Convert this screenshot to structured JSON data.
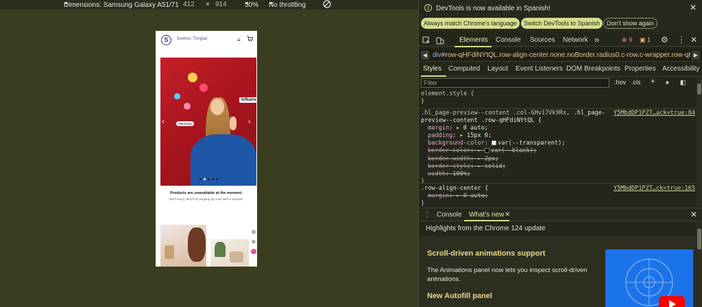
{
  "device_toolbar": {
    "dimensions_label": "Dimensions: Samsung Galaxy A51/71",
    "width": "412",
    "times": "×",
    "height": "914",
    "zoom": "50%",
    "throttling": "No throttling"
  },
  "page": {
    "brand": "Somos Tingtal",
    "hero": {
      "tag_influence": "Influence",
      "tag_marketing": "Marketing"
    },
    "empty_title": "Products are unavailable at the moment.",
    "empty_sub": "Don't worry, they'll be popping up soon with a surprise."
  },
  "devtools": {
    "notice": {
      "text": "DevTools is now available in Spanish!",
      "btn_match": "Always match Chrome's language",
      "btn_switch": "Switch DevTools to Spanish",
      "btn_dismiss": "Don't show again"
    },
    "tabs": [
      "Elements",
      "Console",
      "Sources",
      "Network"
    ],
    "more_tabs": "»",
    "errors": "9",
    "warnings": "1",
    "breadcrumb": {
      "tag": "div",
      "selector": "#row-qHFdiNYtQL.row-align-center.none.noBorder.radius0.c-row.c-wrapper.row-qHFdiNYtQL"
    },
    "style_tabs": [
      "Styles",
      "Computed",
      "Layout",
      "Event Listeners",
      "DOM Breakpoints",
      "Properties",
      "Accessibility"
    ],
    "filter_placeholder": "Filter",
    "filter_hov": ":hov",
    "filter_cls": ".cls",
    "rules": {
      "element_style": "element.style {",
      "close": "}",
      "rule2_sel_a": ".hl_page-preview--content .col-GHv17Vk9Rx, ",
      "rule2_sel_b": ".hl_page-",
      "rule2_sel_c": "preview--content .row-qHFdiNYtQL {",
      "rule2_src": "Y5MbdDP1PZT…ack=true:84",
      "decl_margin_n": "margin",
      "decl_margin_v": "0 auto;",
      "decl_padding_n": "padding",
      "decl_padding_v": "15px 0;",
      "decl_bg_n": "background-color",
      "decl_bg_v": "var(--transparent);",
      "decl_bc_n": "border-color",
      "decl_bc_v": "var(--black);",
      "decl_bw_n": "border-width",
      "decl_bw_v": "2px;",
      "decl_bs_n": "border-style",
      "decl_bs_v": "solid;",
      "decl_w_n": "width",
      "decl_w_v": "100%;",
      "rule3_sel": ".row-align-center {",
      "rule3_src": "Y5MbdDP1PZT…ck=true:165",
      "decl3_margin_n": "margin",
      "decl3_margin_v": "0 auto;"
    },
    "drawer": {
      "tab_console": "Console",
      "tab_whats_new": "What's new",
      "headline": "Highlights from the Chrome 124 update",
      "feature1_title": "Scroll-driven animations support",
      "feature1_desc": "The Animations panel now lets you inspect scroll-driven animations.",
      "feature2_title": "New Autofill panel"
    }
  }
}
